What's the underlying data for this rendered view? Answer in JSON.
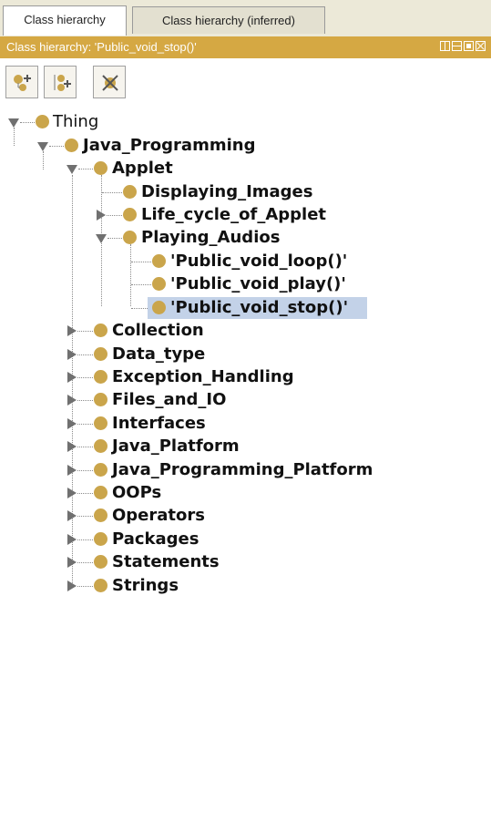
{
  "tabs": [
    "Class hierarchy",
    "Class hierarchy (inferred)"
  ],
  "title_bar": "Class hierarchy: 'Public_void_stop()'",
  "toolbar": {
    "buttons": [
      "add-subclass-icon",
      "add-sibling-class-icon",
      "delete-class-icon"
    ]
  },
  "tree": {
    "root": "Thing",
    "java": "Java_Programming",
    "applet": "Applet",
    "applet_children": [
      "Displaying_Images",
      "Life_cycle_of_Applet",
      "Playing_Audios"
    ],
    "audio_children": [
      "'Public_void_loop()'",
      "'Public_void_play()'",
      "'Public_void_stop()'"
    ],
    "java_children": [
      "Collection",
      "Data_type",
      "Exception_Handling",
      "Files_and_IO",
      "Interfaces",
      "Java_Platform",
      "Java_Programming_Platform",
      "OOPs",
      "Operators",
      "Packages",
      "Statements",
      "Strings"
    ]
  },
  "colors": {
    "accent": "#d5a843",
    "class_dot": "#caa54b",
    "selection": "#c3d2e8"
  }
}
